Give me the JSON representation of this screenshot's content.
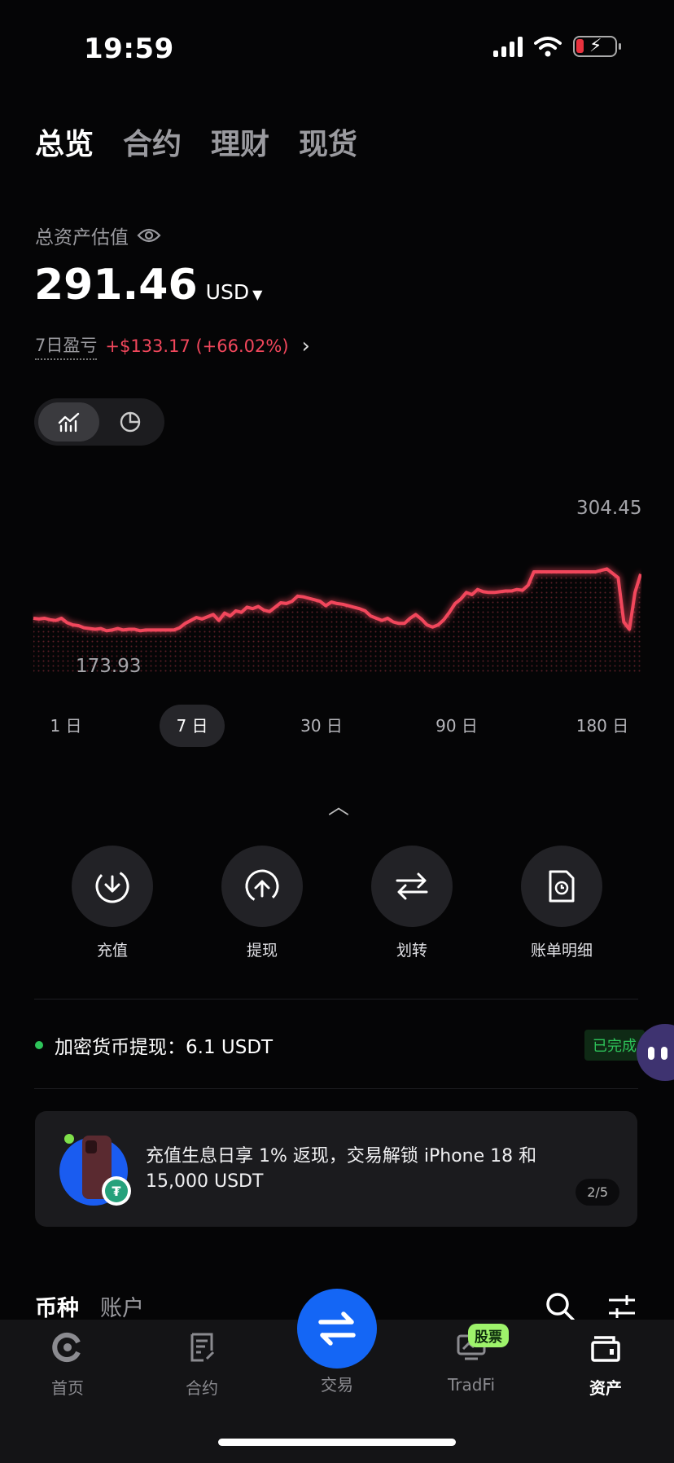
{
  "status_bar": {
    "time": "19:59"
  },
  "top_tabs": [
    {
      "label": "总览",
      "active": true
    },
    {
      "label": "合约",
      "active": false
    },
    {
      "label": "理财",
      "active": false
    },
    {
      "label": "现货",
      "active": false
    }
  ],
  "summary": {
    "estimate_label": "总资产估值",
    "balance": "291.46",
    "currency": "USD",
    "pnl_label": "7日盈亏",
    "pnl_value": "+$133.17 (+66.02%)"
  },
  "chart": {
    "max_label": "304.45",
    "min_label": "173.93",
    "line_color": "#f2475c",
    "chart_data": {
      "type": "line",
      "ylim": [
        173.93,
        304.45
      ],
      "values": [
        195,
        194,
        195,
        193,
        192,
        195,
        189,
        186,
        185,
        182,
        181,
        180,
        181,
        178,
        179,
        181,
        179,
        180,
        180,
        178,
        179,
        179,
        179,
        179,
        179,
        179,
        182,
        188,
        192,
        196,
        194,
        197,
        200,
        192,
        202,
        198,
        205,
        203,
        210,
        208,
        211,
        206,
        204,
        210,
        216,
        215,
        218,
        225,
        224,
        222,
        220,
        218,
        212,
        217,
        215,
        214,
        212,
        210,
        208,
        205,
        198,
        195,
        192,
        195,
        190,
        188,
        188,
        195,
        200,
        194,
        186,
        183,
        186,
        193,
        203,
        215,
        221,
        230,
        227,
        234,
        231,
        230,
        230,
        231,
        232,
        232,
        234,
        233,
        240,
        258,
        258,
        258,
        258,
        258,
        258,
        258,
        258,
        258,
        258,
        258,
        258,
        260,
        262,
        256,
        250,
        190,
        180,
        230,
        255
      ]
    }
  },
  "periods": [
    {
      "label": "1 日",
      "active": false
    },
    {
      "label": "7 日",
      "active": true
    },
    {
      "label": "30 日",
      "active": false
    },
    {
      "label": "90 日",
      "active": false
    },
    {
      "label": "180 日",
      "active": false
    }
  ],
  "actions": [
    {
      "label": "充值",
      "icon": "deposit-icon"
    },
    {
      "label": "提现",
      "icon": "withdraw-icon"
    },
    {
      "label": "划转",
      "icon": "transfer-icon"
    },
    {
      "label": "账单明细",
      "icon": "bill-icon"
    }
  ],
  "notice": {
    "text": "加密货币提现：6.1 USDT",
    "status": "已完成"
  },
  "promo": {
    "text": "充值生息日享 1% 返现，交易解锁 iPhone 18 和 15,000 USDT",
    "page": "2/5"
  },
  "sub_tabs": [
    {
      "label": "币种",
      "active": true
    },
    {
      "label": "账户",
      "active": false
    }
  ],
  "bottom_nav": [
    {
      "label": "首页",
      "icon": "home-icon"
    },
    {
      "label": "合约",
      "icon": "contract-icon"
    },
    {
      "label": "交易",
      "icon": "trade-icon"
    },
    {
      "label": "TradFi",
      "icon": "tradfi-icon",
      "badge": "股票"
    },
    {
      "label": "资产",
      "icon": "wallet-icon",
      "active": true
    }
  ]
}
